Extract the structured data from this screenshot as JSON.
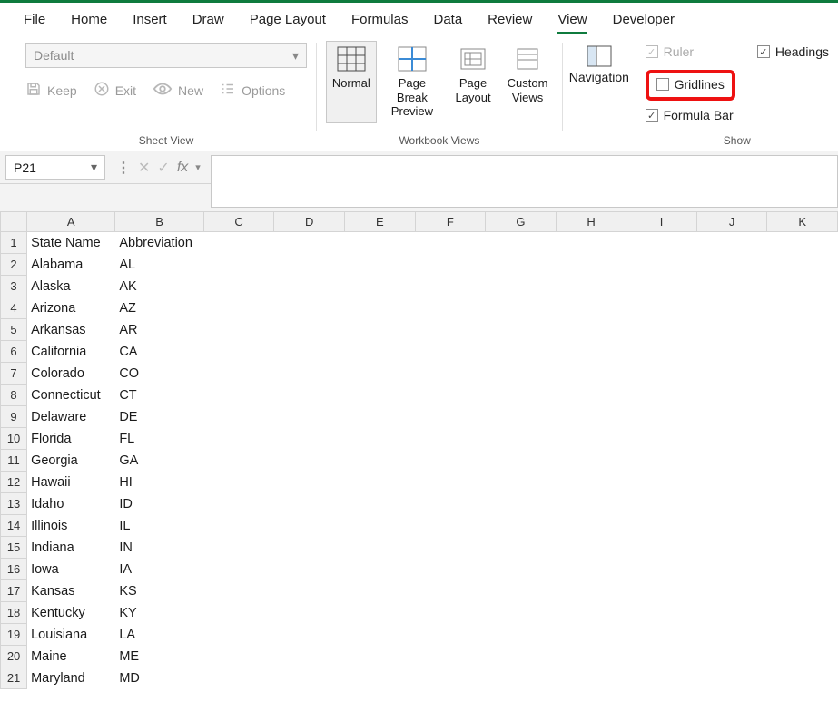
{
  "tabs": {
    "items": [
      "File",
      "Home",
      "Insert",
      "Draw",
      "Page Layout",
      "Formulas",
      "Data",
      "Review",
      "View",
      "Developer"
    ],
    "active": "View"
  },
  "ribbon": {
    "sheet_view": {
      "dropdown_text": "Default",
      "keep": "Keep",
      "exit": "Exit",
      "new": "New",
      "options": "Options",
      "group_label": "Sheet View"
    },
    "workbook_views": {
      "normal": "Normal",
      "page_break": "Page Break Preview",
      "page_layout": "Page Layout",
      "custom": "Custom Views",
      "group_label": "Workbook Views"
    },
    "navigation": "Navigation",
    "show": {
      "ruler": "Ruler",
      "gridlines": "Gridlines",
      "formula_bar": "Formula Bar",
      "headings": "Headings",
      "group_label": "Show"
    }
  },
  "formula_bar": {
    "name_box": "P21",
    "fx": "fx",
    "value": ""
  },
  "columns": [
    "A",
    "B",
    "C",
    "D",
    "E",
    "F",
    "G",
    "H",
    "I",
    "J",
    "K"
  ],
  "rows": [
    {
      "n": "1",
      "a": "State Name",
      "b": "Abbreviation"
    },
    {
      "n": "2",
      "a": "Alabama",
      "b": "AL"
    },
    {
      "n": "3",
      "a": "Alaska",
      "b": "AK"
    },
    {
      "n": "4",
      "a": "Arizona",
      "b": "AZ"
    },
    {
      "n": "5",
      "a": "Arkansas",
      "b": "AR"
    },
    {
      "n": "6",
      "a": "California",
      "b": "CA"
    },
    {
      "n": "7",
      "a": "Colorado",
      "b": "CO"
    },
    {
      "n": "8",
      "a": "Connecticut",
      "b": "CT"
    },
    {
      "n": "9",
      "a": "Delaware",
      "b": "DE"
    },
    {
      "n": "10",
      "a": "Florida",
      "b": "FL"
    },
    {
      "n": "11",
      "a": "Georgia",
      "b": "GA"
    },
    {
      "n": "12",
      "a": "Hawaii",
      "b": "HI"
    },
    {
      "n": "13",
      "a": "Idaho",
      "b": "ID"
    },
    {
      "n": "14",
      "a": "Illinois",
      "b": "IL"
    },
    {
      "n": "15",
      "a": "Indiana",
      "b": "IN"
    },
    {
      "n": "16",
      "a": "Iowa",
      "b": "IA"
    },
    {
      "n": "17",
      "a": "Kansas",
      "b": "KS"
    },
    {
      "n": "18",
      "a": "Kentucky",
      "b": "KY"
    },
    {
      "n": "19",
      "a": "Louisiana",
      "b": "LA"
    },
    {
      "n": "20",
      "a": "Maine",
      "b": "ME"
    },
    {
      "n": "21",
      "a": "Maryland",
      "b": "MD"
    }
  ]
}
